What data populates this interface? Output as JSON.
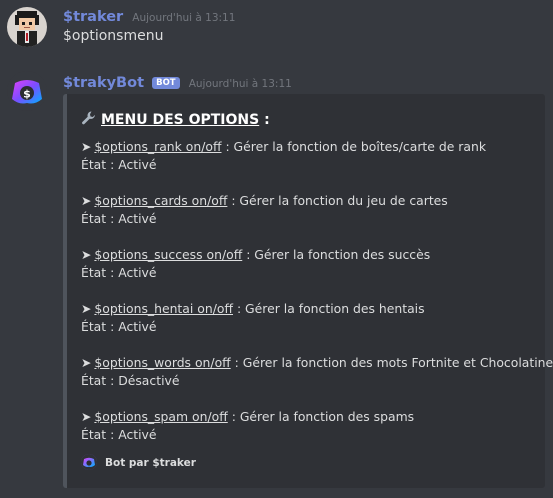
{
  "messages": [
    {
      "username": "$traker",
      "username_color": "#7289da",
      "timestamp": "Aujourd'hui à 13:11",
      "content": "$optionsmenu",
      "avatar_icon": "pixel-character-avatar"
    },
    {
      "username": "$trakyBot",
      "username_color": "#7289da",
      "badge": "BOT",
      "timestamp": "Aujourd'hui à 13:11",
      "avatar_icon": "discord-logo-avatar"
    }
  ],
  "embed": {
    "title_icon": "wrench-icon",
    "title": "MENU DES OPTIONS",
    "title_suffix": " :",
    "options": [
      {
        "arrow": "➤",
        "command": "$options_rank on/off",
        "description": " : Gérer la fonction de boîtes/carte de rank",
        "status": "État : Activé"
      },
      {
        "arrow": "➤",
        "command": "$options_cards on/off",
        "description": " : Gérer la fonction du jeu de cartes",
        "status": "État : Activé"
      },
      {
        "arrow": "➤",
        "command": "$options_success on/off",
        "description": " : Gérer la fonction des succès",
        "status": "État : Activé"
      },
      {
        "arrow": "➤",
        "command": "$options_hentai on/off",
        "description": " : Gérer la fonction des hentais",
        "status": "État : Activé"
      },
      {
        "arrow": "➤",
        "command": "$options_words on/off",
        "description": " : Gérer la fonction des mots Fortnite et Chocolatine",
        "status": "État : Désactivé"
      },
      {
        "arrow": "➤",
        "command": "$options_spam on/off",
        "description": " : Gérer la fonction des spams",
        "status": "État : Activé"
      }
    ],
    "footer": "Bot par $traker"
  },
  "colors": {
    "background": "#36393f",
    "embed_background": "#2f3136",
    "embed_border": "#4f545c",
    "badge": "#7289da"
  }
}
